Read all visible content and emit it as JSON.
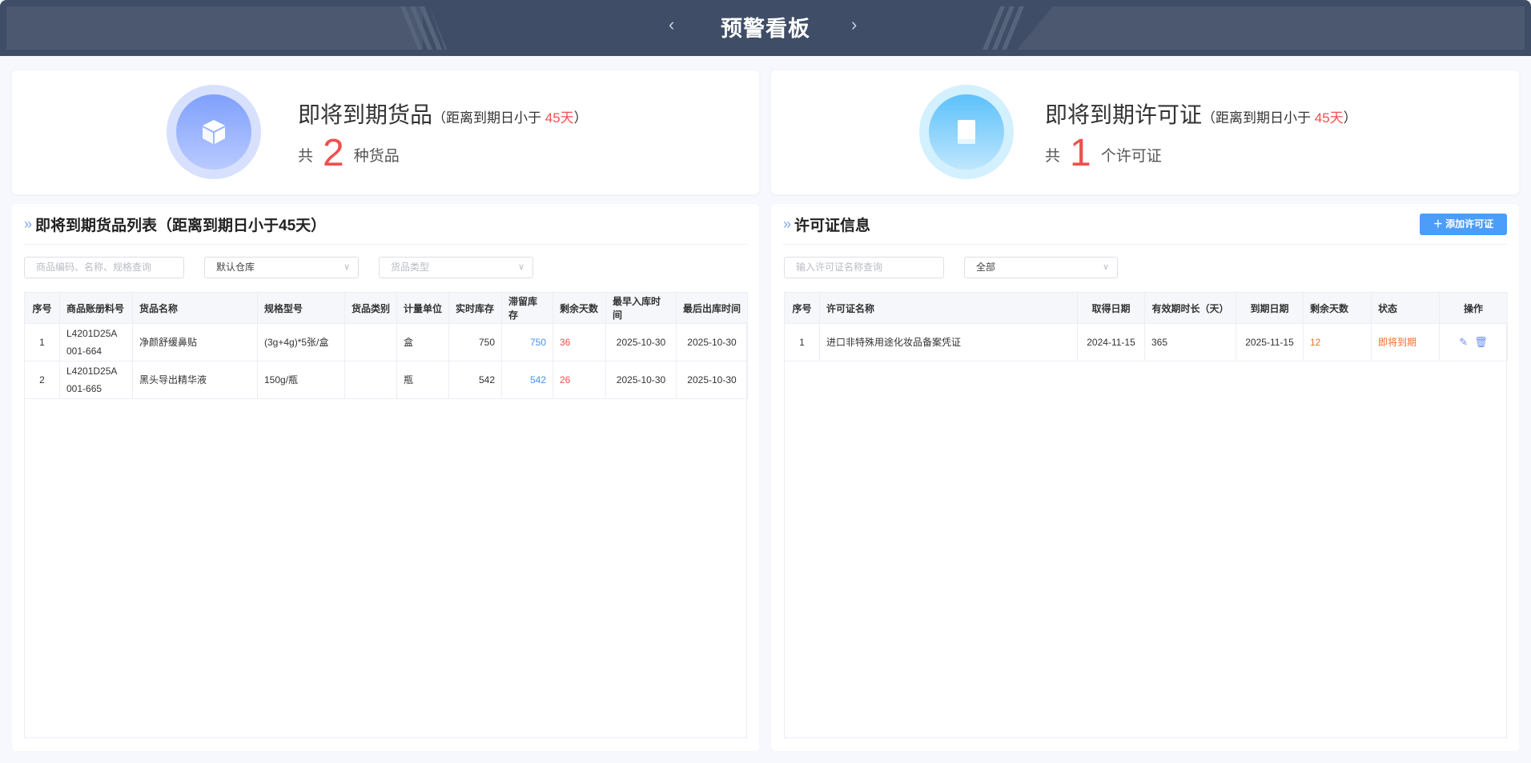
{
  "header": {
    "title": "预警看板",
    "prev_icon": "chevron-left",
    "next_icon": "chevron-right"
  },
  "goods_card": {
    "icon": "box-icon",
    "title": "即将到期货品",
    "sub_prefix": "（距离到期日小于 ",
    "sub_days": "45天",
    "sub_suffix": "）",
    "count_prefix": "共",
    "count": "2",
    "count_suffix": "种货品"
  },
  "license_card": {
    "icon": "book-icon",
    "title": "即将到期许可证",
    "sub_prefix": "（距离到期日小于 ",
    "sub_days": "45天",
    "sub_suffix": "）",
    "count_prefix": "共",
    "count": "1",
    "count_suffix": "个许可证"
  },
  "goods_panel": {
    "title": "即将到期货品列表（距离到期日小于45天）",
    "search_placeholder": "商品编码、名称、规格查询",
    "warehouse_select": "默认仓库",
    "type_select_placeholder": "货品类型",
    "columns": [
      "序号",
      "商品账册料号",
      "货品名称",
      "规格型号",
      "货品类别",
      "计量单位",
      "实时库存",
      "滞留库存",
      "剩余天数",
      "最早入库时间",
      "最后出库时间"
    ],
    "rows": [
      {
        "no": "1",
        "code1": "L4201D25A",
        "code2": "001-664",
        "name": "净颜舒缓鼻贴",
        "spec": "(3g+4g)*5张/盒",
        "category": "",
        "unit": "盒",
        "stock": "750",
        "stale": "750",
        "days": "36",
        "first_in": "2025-10-30",
        "last_out": "2025-10-30"
      },
      {
        "no": "2",
        "code1": "L4201D25A",
        "code2": "001-665",
        "name": "黑头导出精华液",
        "spec": "150g/瓶",
        "category": "",
        "unit": "瓶",
        "stock": "542",
        "stale": "542",
        "days": "26",
        "first_in": "2025-10-30",
        "last_out": "2025-10-30"
      }
    ]
  },
  "license_panel": {
    "title": "许可证信息",
    "add_button": "添加许可证",
    "search_placeholder": "输入许可证名称查询",
    "status_select": "全部",
    "columns": [
      "序号",
      "许可证名称",
      "取得日期",
      "有效期时长（天）",
      "到期日期",
      "剩余天数",
      "状态",
      "操作"
    ],
    "rows": [
      {
        "no": "1",
        "name": "进口非特殊用途化妆品备案凭证",
        "obtained": "2024-11-15",
        "duration": "365",
        "expiry": "2025-11-15",
        "days": "12",
        "status": "即将到期"
      }
    ]
  },
  "colors": {
    "accent": "#4b9df8",
    "danger": "#f0504d",
    "warning": "#f56c2d",
    "header_bg": "#3f4d66"
  }
}
